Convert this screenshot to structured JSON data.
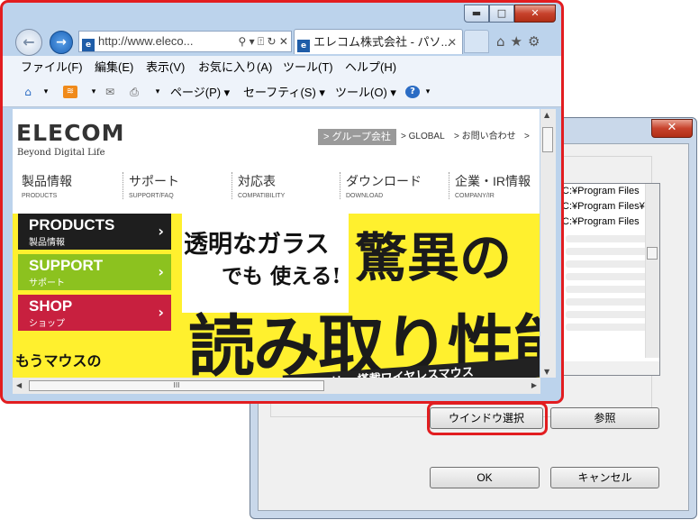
{
  "browser": {
    "address_url": "http://www.eleco...",
    "tab_title": "エレコム株式会社 - パソ...",
    "back_glyph": "←",
    "forward_glyph": "→",
    "caption_minimize": "▬",
    "caption_maximize": "□",
    "caption_close": "✕",
    "tab_close": "✕",
    "address_icons": "⚲ ▾ ⍐ ↻ ✕",
    "toolbar_right_icons": "⌂★⚙",
    "menu": [
      "ファイル(F)",
      "編集(E)",
      "表示(V)",
      "お気に入り(A)",
      "ツール(T)",
      "ヘルプ(H)"
    ],
    "command": {
      "page": "ページ(P) ▾",
      "safety": "セーフティ(S) ▾",
      "tools": "ツール(O) ▾",
      "help_icon": "?"
    }
  },
  "page": {
    "logo": "ELECOM",
    "tagline": "Beyond Digital Life",
    "group_link": "> グループ会社",
    "global_link": "> GLOBAL",
    "contact_link": "> お問い合わせ",
    "more_link": "> ",
    "nav": [
      {
        "jp": "製品情報",
        "en": "PRODUCTS"
      },
      {
        "jp": "サポート",
        "en": "SUPPORT/FAQ"
      },
      {
        "jp": "対応表",
        "en": "COMPATIBILITY"
      },
      {
        "jp": "ダウンロード",
        "en": "DOWNLOAD"
      },
      {
        "jp": "企業・IR情報",
        "en": "COMPANY/IR"
      }
    ],
    "side": [
      {
        "title": "PRODUCTS",
        "sub": "製品情報",
        "color": "#1e1e1e"
      },
      {
        "title": "SUPPORT",
        "sub": "サポート",
        "color": "#8cc21f"
      },
      {
        "title": "SHOP",
        "sub": "ショップ",
        "color": "#c8203f"
      }
    ],
    "arrow": "›",
    "banner": {
      "line1": "透明なガラス",
      "line2": "でも 使える!",
      "big1": "驚異の",
      "big2": "読み取り性能",
      "small": "もうマウスの",
      "strip": "…リー 搭載ワイヤレスマウス"
    },
    "hscroll_grip": "III",
    "scroll_up": "▲",
    "scroll_down": "▼",
    "scroll_left": "◀",
    "scroll_right": "▶"
  },
  "dialog": {
    "close": "✕",
    "list_items": [
      "C:¥Program Files",
      "C:¥Program Files¥",
      "C:¥Program Files"
    ],
    "select_window_btn": "ウインドウ選択",
    "browse_btn": "参照",
    "ok_btn": "OK",
    "cancel_btn": "キャンセル"
  },
  "colors": {
    "highlight": "#e21d20",
    "accent_blue": "#1f5da8",
    "banner_yellow": "#fff02e"
  }
}
